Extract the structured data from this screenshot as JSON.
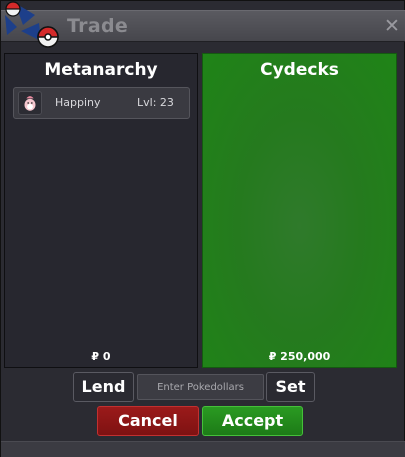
{
  "window": {
    "title": "Trade",
    "close_label": "✕"
  },
  "left_panel": {
    "name": "Metanarchy",
    "items": [
      {
        "name": "Happiny",
        "level": "Lvl: 23",
        "icon": "happiny-icon"
      }
    ],
    "money": "₽ 0"
  },
  "right_panel": {
    "name": "Cydecks",
    "money": "₽ 250,000",
    "accent": "#1f8417"
  },
  "controls": {
    "lend_label": "Lend",
    "pokedollar_placeholder": "Enter Pokedollars",
    "set_label": "Set",
    "cancel_label": "Cancel",
    "accept_label": "Accept"
  }
}
